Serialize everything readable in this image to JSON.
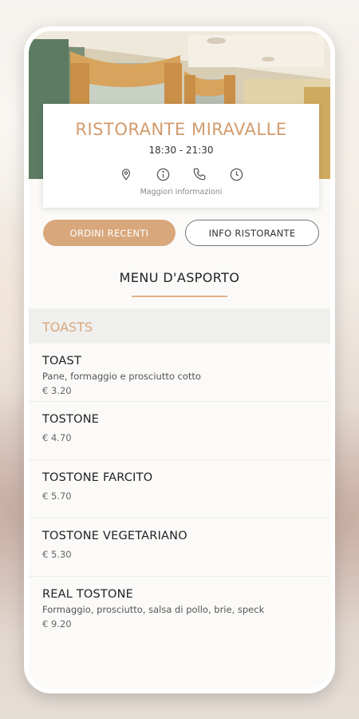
{
  "restaurant": {
    "name": "RISTORANTE MIRAVALLE",
    "hours": "18:30 - 21:30",
    "more_info": "Maggiori informazioni",
    "icons": [
      "location-pin-icon",
      "info-icon",
      "phone-icon",
      "clock-icon"
    ]
  },
  "buttons": {
    "recent_orders": "ORDINI RECENTI",
    "restaurant_info": "INFO RISTORANTE"
  },
  "menu": {
    "title": "MENU D'ASPORTO",
    "sections": [
      {
        "title": "TOASTS",
        "items": [
          {
            "name": "TOAST",
            "description": "Pane, formaggio e prosciutto cotto",
            "price": "€ 3.20"
          },
          {
            "name": "TOSTONE",
            "description": "",
            "price": "€ 4.70"
          },
          {
            "name": "TOSTONE FARCITO",
            "description": "",
            "price": "€ 5.70"
          },
          {
            "name": "TOSTONE VEGETARIANO",
            "description": "",
            "price": "€ 5.30"
          },
          {
            "name": "REAL TOSTONE",
            "description": "Formaggio, prosciutto, salsa di pollo, brie, speck",
            "price": "€ 9.20"
          }
        ]
      }
    ]
  },
  "colors": {
    "accent": "#d9a77c",
    "accent_text": "#d29b6d",
    "section_bg": "#efefed"
  }
}
